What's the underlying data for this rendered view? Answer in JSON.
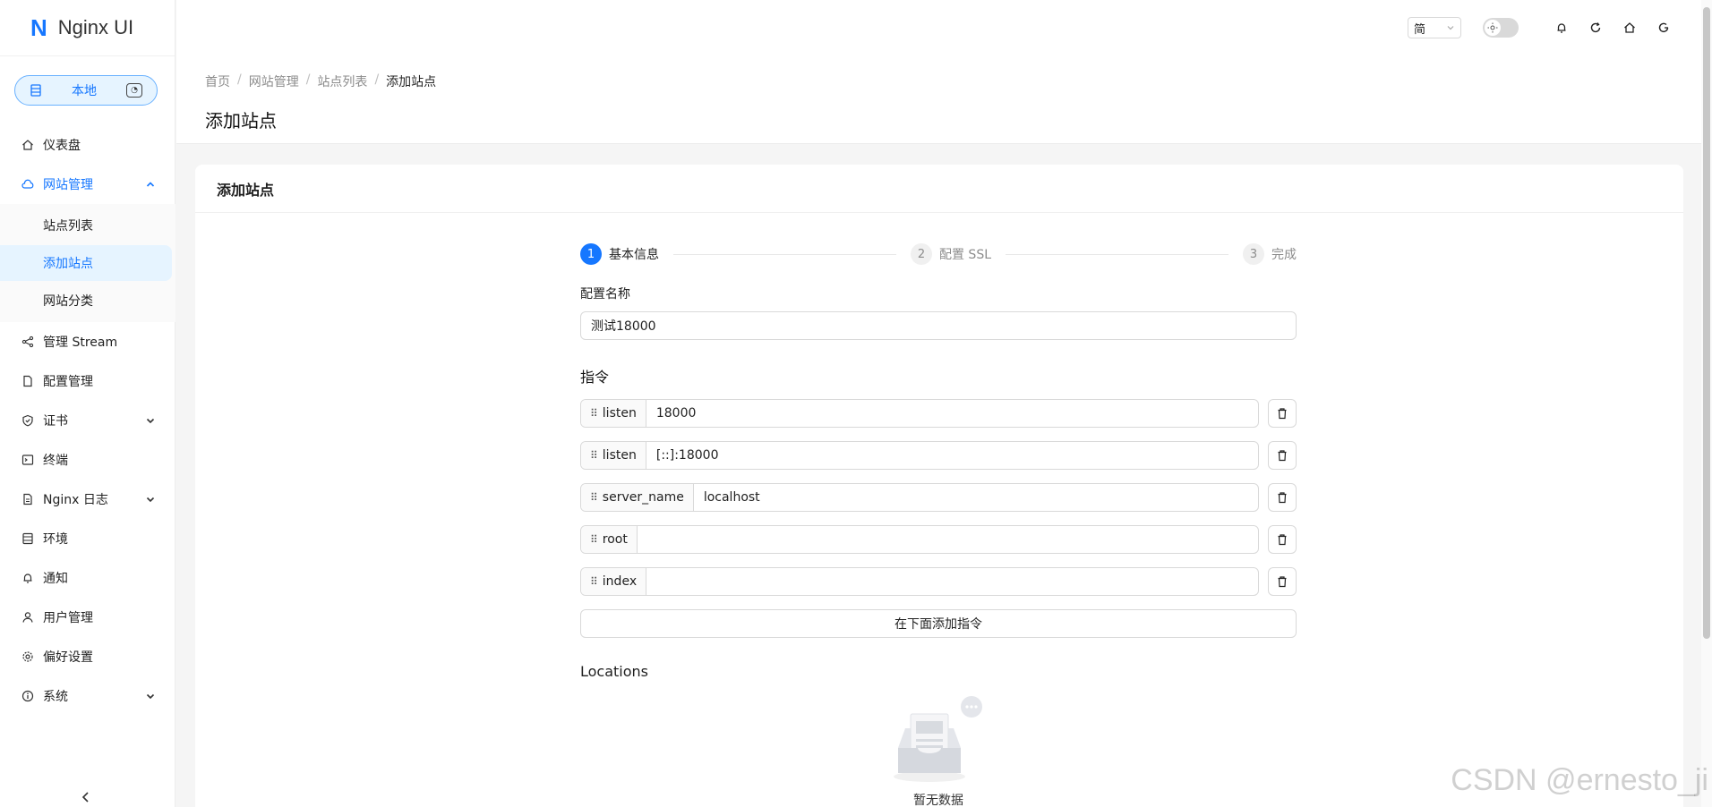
{
  "app": {
    "logo_letter": "N",
    "name": "Nginx UI"
  },
  "node": {
    "label": "本地"
  },
  "sidebar": {
    "items": [
      {
        "label": "仪表盘"
      },
      {
        "label": "网站管理"
      },
      {
        "label": "管理 Stream"
      },
      {
        "label": "配置管理"
      },
      {
        "label": "证书"
      },
      {
        "label": "终端"
      },
      {
        "label": "Nginx 日志"
      },
      {
        "label": "环境"
      },
      {
        "label": "通知"
      },
      {
        "label": "用户管理"
      },
      {
        "label": "偏好设置"
      },
      {
        "label": "系统"
      }
    ],
    "site_submenu": [
      {
        "label": "站点列表"
      },
      {
        "label": "添加站点"
      },
      {
        "label": "网站分类"
      }
    ]
  },
  "header": {
    "language": "简"
  },
  "breadcrumb": [
    "首页",
    "网站管理",
    "站点列表",
    "添加站点"
  ],
  "breadcrumb_sep": "/",
  "page_title": "添加站点",
  "card": {
    "title": "添加站点"
  },
  "steps": [
    {
      "num": "1",
      "label": "基本信息"
    },
    {
      "num": "2",
      "label": "配置 SSL"
    },
    {
      "num": "3",
      "label": "完成"
    }
  ],
  "form": {
    "config_name_label": "配置名称",
    "config_name_value": "测试18000",
    "directives_title": "指令",
    "directives": [
      {
        "name": "listen",
        "value": "18000"
      },
      {
        "name": "listen",
        "value": "[::]:18000"
      },
      {
        "name": "server_name",
        "value": "localhost"
      },
      {
        "name": "root",
        "value": ""
      },
      {
        "name": "index",
        "value": ""
      }
    ],
    "add_directive_label": "在下面添加指令",
    "locations_title": "Locations",
    "empty_text": "暂无数据"
  },
  "watermark": "CSDN @ernesto_ji",
  "colors": {
    "primary": "#1677ff",
    "primary_bg": "#e6f4ff"
  }
}
